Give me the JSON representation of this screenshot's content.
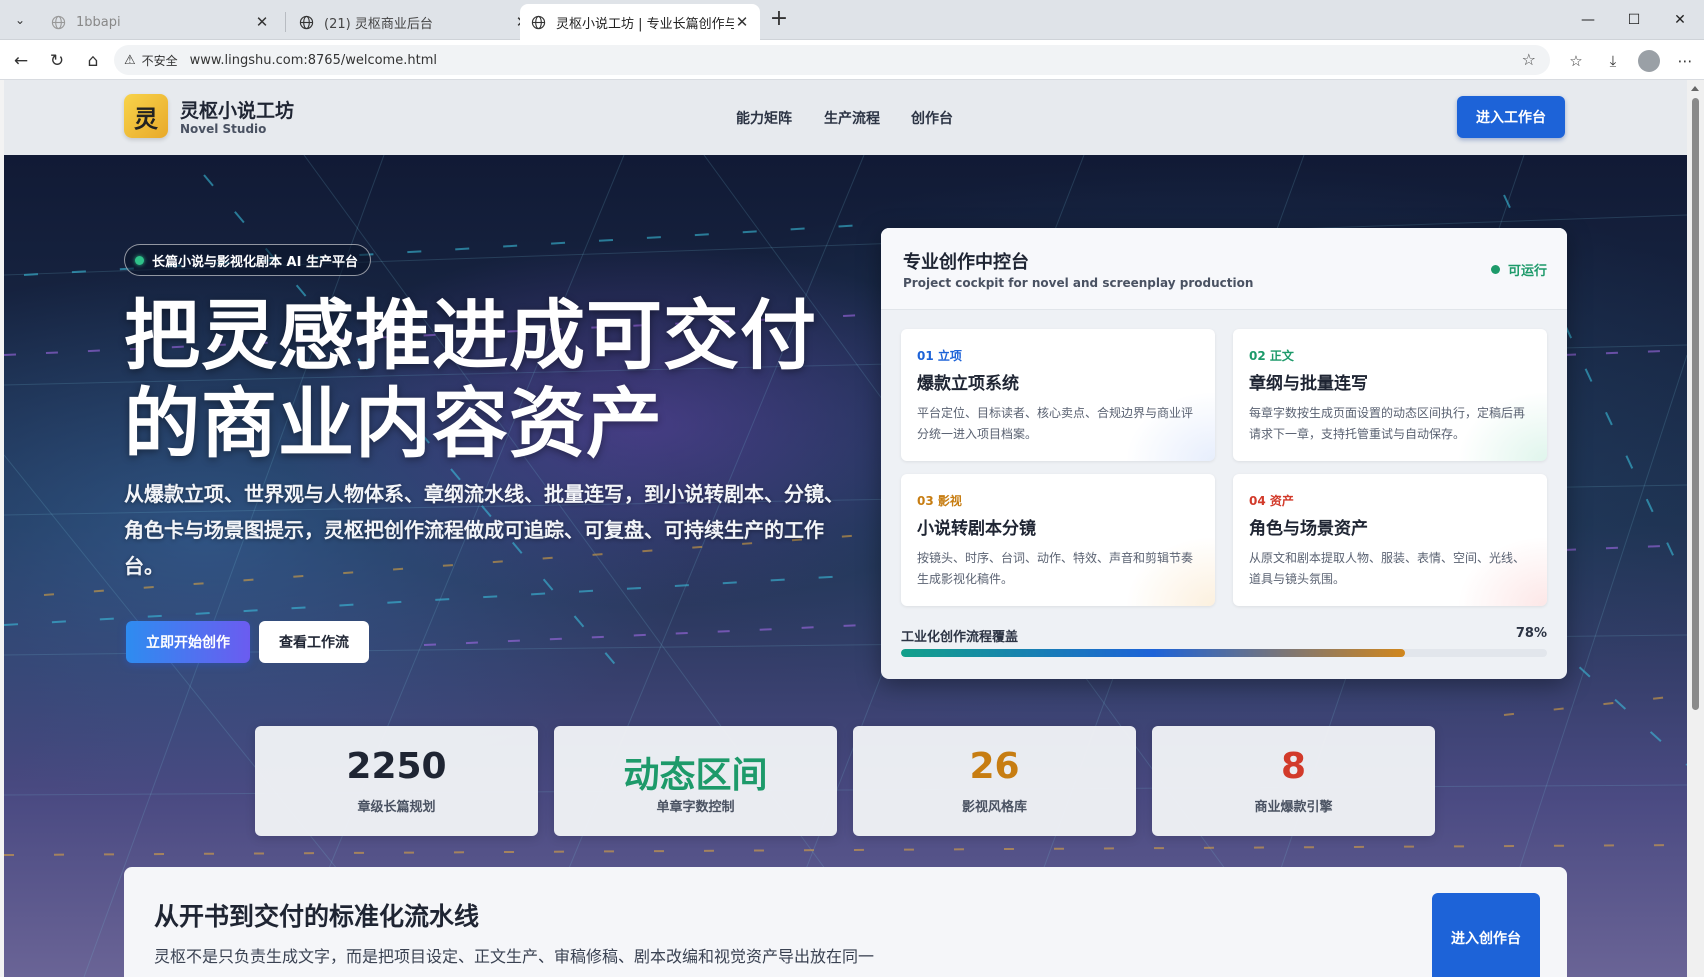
{
  "browser": {
    "tabs": [
      {
        "title": "1bbapi"
      },
      {
        "title": "(21) 灵枢商业后台"
      },
      {
        "title": "灵枢小说工坊 | 专业长篇创作与影视"
      }
    ],
    "insecure_label": "不安全",
    "url": "www.lingshu.com:8765/welcome.html"
  },
  "header": {
    "logo_char": "灵",
    "brand_name": "灵枢小说工坊",
    "brand_sub": "Novel Studio",
    "nav": [
      "能力矩阵",
      "生产流程",
      "创作台"
    ],
    "cta": "进入工作台"
  },
  "hero": {
    "badge": "长篇小说与影视化剧本 AI 生产平台",
    "title_line1": "把灵感推进成可交付",
    "title_line2": "的商业内容资产",
    "description": "从爆款立项、世界观与人物体系、章纲流水线、批量连写，到小说转剧本、分镜、角色卡与场景图提示，灵枢把创作流程做成可追踪、可复盘、可持续生产的工作台。",
    "btn_primary": "立即开始创作",
    "btn_secondary": "查看工作流"
  },
  "cockpit": {
    "title": "专业创作中控台",
    "subtitle": "Project cockpit for novel and screenplay production",
    "status": "可运行",
    "modules": [
      {
        "tag": "01 立项",
        "tag_color": "#1d63d8",
        "name": "爆款立项系统",
        "desc": "平台定位、目标读者、核心卖点、合规边界与商业评分统一进入项目档案。"
      },
      {
        "tag": "02 正文",
        "tag_color": "#1d9a6a",
        "name": "章纲与批量连写",
        "desc": "每章字数按生成页面设置的动态区间执行，定稿后再请求下一章，支持托管重试与自动保存。"
      },
      {
        "tag": "03 影视",
        "tag_color": "#c77d12",
        "name": "小说转剧本分镜",
        "desc": "按镜头、时序、台词、动作、特效、声音和剪辑节奏生成影视化稿件。"
      },
      {
        "tag": "04 资产",
        "tag_color": "#d23a2a",
        "name": "角色与场景资产",
        "desc": "从原文和剧本提取人物、服装、表情、空间、光线、道具与镜头氛围。"
      }
    ],
    "progress_label": "工业化创作流程覆盖",
    "progress_pct_text": "78%",
    "progress_value": 0.78
  },
  "stats": [
    {
      "value": "2250",
      "label": "章级长篇规划",
      "color": "#1f2533"
    },
    {
      "value": "动态区间",
      "label": "单章字数控制",
      "color": "#1d9a6a"
    },
    {
      "value": "26",
      "label": "影视风格库",
      "color": "#c77d12"
    },
    {
      "value": "8",
      "label": "商业爆款引擎",
      "color": "#d23a2a"
    }
  ],
  "section": {
    "title": "从开书到交付的标准化流水线",
    "desc": "灵枢不是只负责生成文字，而是把项目设定、正文生产、审稿修稿、剧本改编和视觉资产导出放在同一",
    "cta": "进入创作台"
  }
}
